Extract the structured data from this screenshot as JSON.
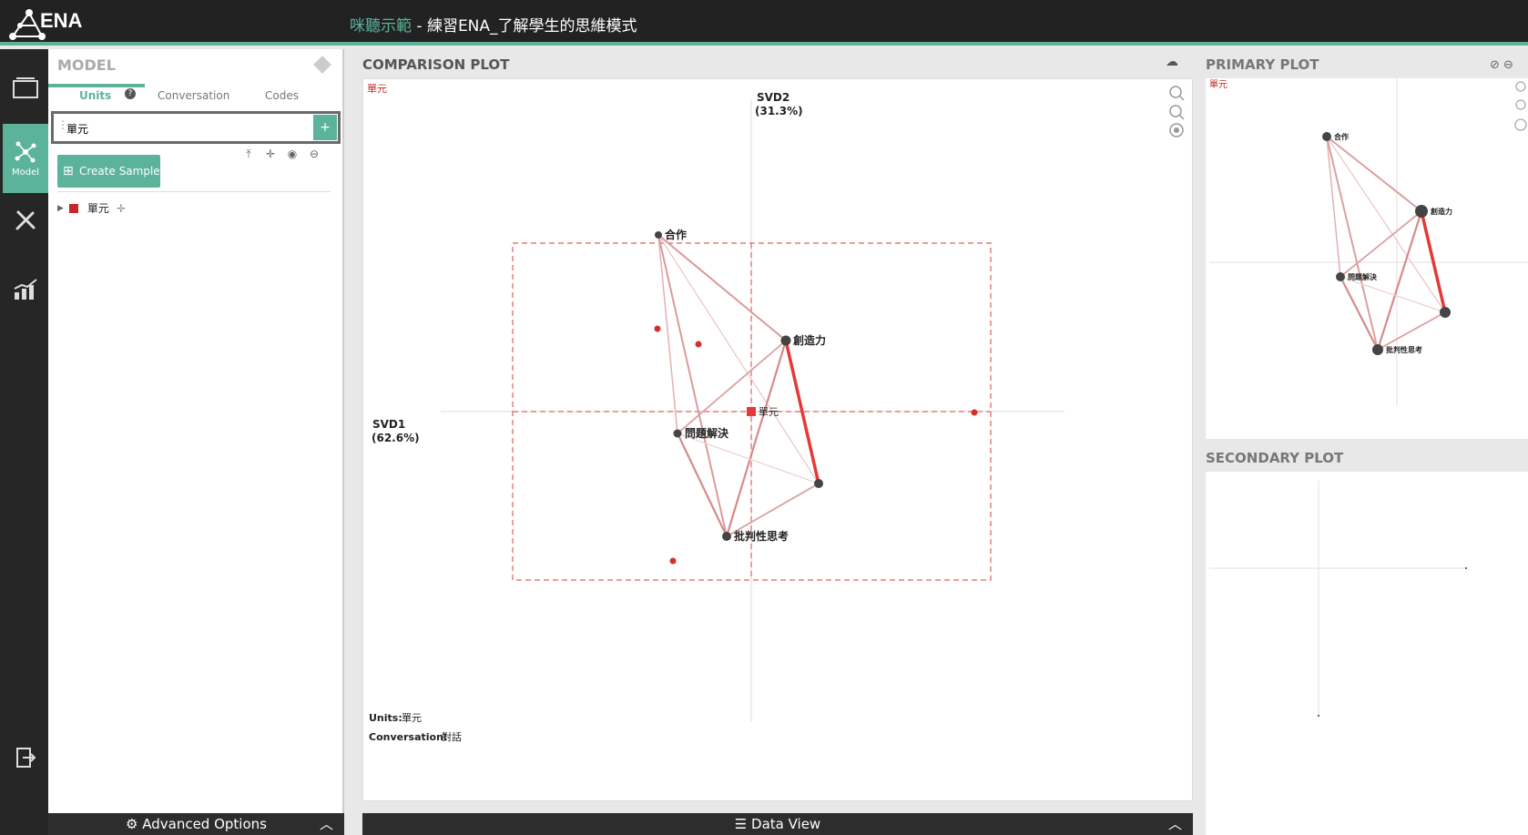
{
  "header": {
    "logo": "ENA",
    "title_accent": "咪聽示範",
    "title_rest": " - 練習ENA_了解學生的思維模式"
  },
  "rail": {
    "items": [
      {
        "icon": "folder-icon",
        "label": ""
      },
      {
        "icon": "network-icon",
        "label": "Model"
      },
      {
        "icon": "tools-icon",
        "label": ""
      },
      {
        "icon": "chart-icon",
        "label": ""
      },
      {
        "icon": "logout-icon",
        "label": ""
      }
    ]
  },
  "model_panel": {
    "title": "MODEL",
    "tabs": [
      "Units",
      "Conversation",
      "Codes"
    ],
    "help": "?",
    "search_value": "單元",
    "add_label": "+",
    "create_sample": "Create Sample",
    "tree_item": "單元",
    "advanced_options": "Advanced Options"
  },
  "comparison": {
    "title": "COMPARISON PLOT",
    "corner_label": "單元",
    "svd2_label": "SVD2",
    "svd2_pct": "(31.3%)",
    "svd1_label": "SVD1",
    "svd1_pct": "(62.6%)",
    "mean_label": "單元",
    "nodes": {
      "n1": "合作",
      "n2": "創造力",
      "n3": "問題解決",
      "n4": "批判性思考"
    },
    "units_label": "Units:",
    "units_value": "單元",
    "conv_label": "Conversation:",
    "conv_value": "對話",
    "data_view": "Data View"
  },
  "primary": {
    "title": "PRIMARY PLOT",
    "corner_label": "單元",
    "nodes": {
      "n1": "合作",
      "n2": "創造力",
      "n3": "問題解決",
      "n4": "批判性思考"
    }
  },
  "secondary": {
    "title": "SECONDARY PLOT"
  },
  "colors": {
    "accent": "#5bb39c",
    "red": "#e53935",
    "dark": "#222222"
  }
}
